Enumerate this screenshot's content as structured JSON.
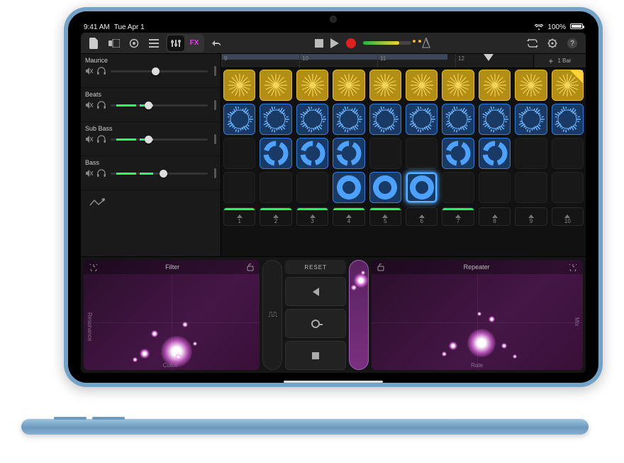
{
  "status": {
    "time": "9:41 AM",
    "date": "Tue Apr 1",
    "battery_pct": "100%"
  },
  "toolbar": {
    "fx_label": "FX",
    "bars_label": "1 Bar"
  },
  "ruler": {
    "marks": [
      "9",
      "10",
      "11",
      "12"
    ]
  },
  "tracks": [
    {
      "name": "Maurice",
      "color": "#e0b62a",
      "slider_pos": 0.42,
      "instr": "drum-machine",
      "green": false
    },
    {
      "name": "Beats",
      "color": "#2f7ddf",
      "slider_pos": 0.35,
      "instr": "sequencer",
      "green": true
    },
    {
      "name": "Sub Bass",
      "color": "#2f7ddf",
      "slider_pos": 0.35,
      "instr": "drum-sticks",
      "green": true
    },
    {
      "name": "Bass",
      "color": "#2f7ddf",
      "slider_pos": 0.5,
      "instr": "synth-keys",
      "green": true
    }
  ],
  "columns": [
    1,
    2,
    3,
    4,
    5,
    6,
    7,
    8,
    9,
    10
  ],
  "green_columns": [
    1,
    2,
    3,
    4,
    5,
    7
  ],
  "grid": {
    "rows": [
      {
        "cells": [
          "y",
          "y",
          "y",
          "y",
          "y",
          "y",
          "y",
          "y",
          "y",
          "yplay"
        ]
      },
      {
        "cells": [
          "b",
          "b",
          "b",
          "b",
          "b",
          "b",
          "b",
          "b",
          "b",
          "b"
        ]
      },
      {
        "cells": [
          "e",
          "b",
          "b",
          "b",
          "e",
          "e",
          "b",
          "b",
          "e",
          "e"
        ]
      },
      {
        "cells": [
          "e",
          "e",
          "e",
          "b",
          "b",
          "bSel",
          "e",
          "e",
          "e",
          "e"
        ]
      }
    ]
  },
  "fx": {
    "left": {
      "title": "Filter",
      "x_label": "Cutoff",
      "y_label": "Resonance"
    },
    "right": {
      "title": "Repeater",
      "x_label": "Rate",
      "y_label": "Mix"
    },
    "reset_label": "RESET"
  }
}
